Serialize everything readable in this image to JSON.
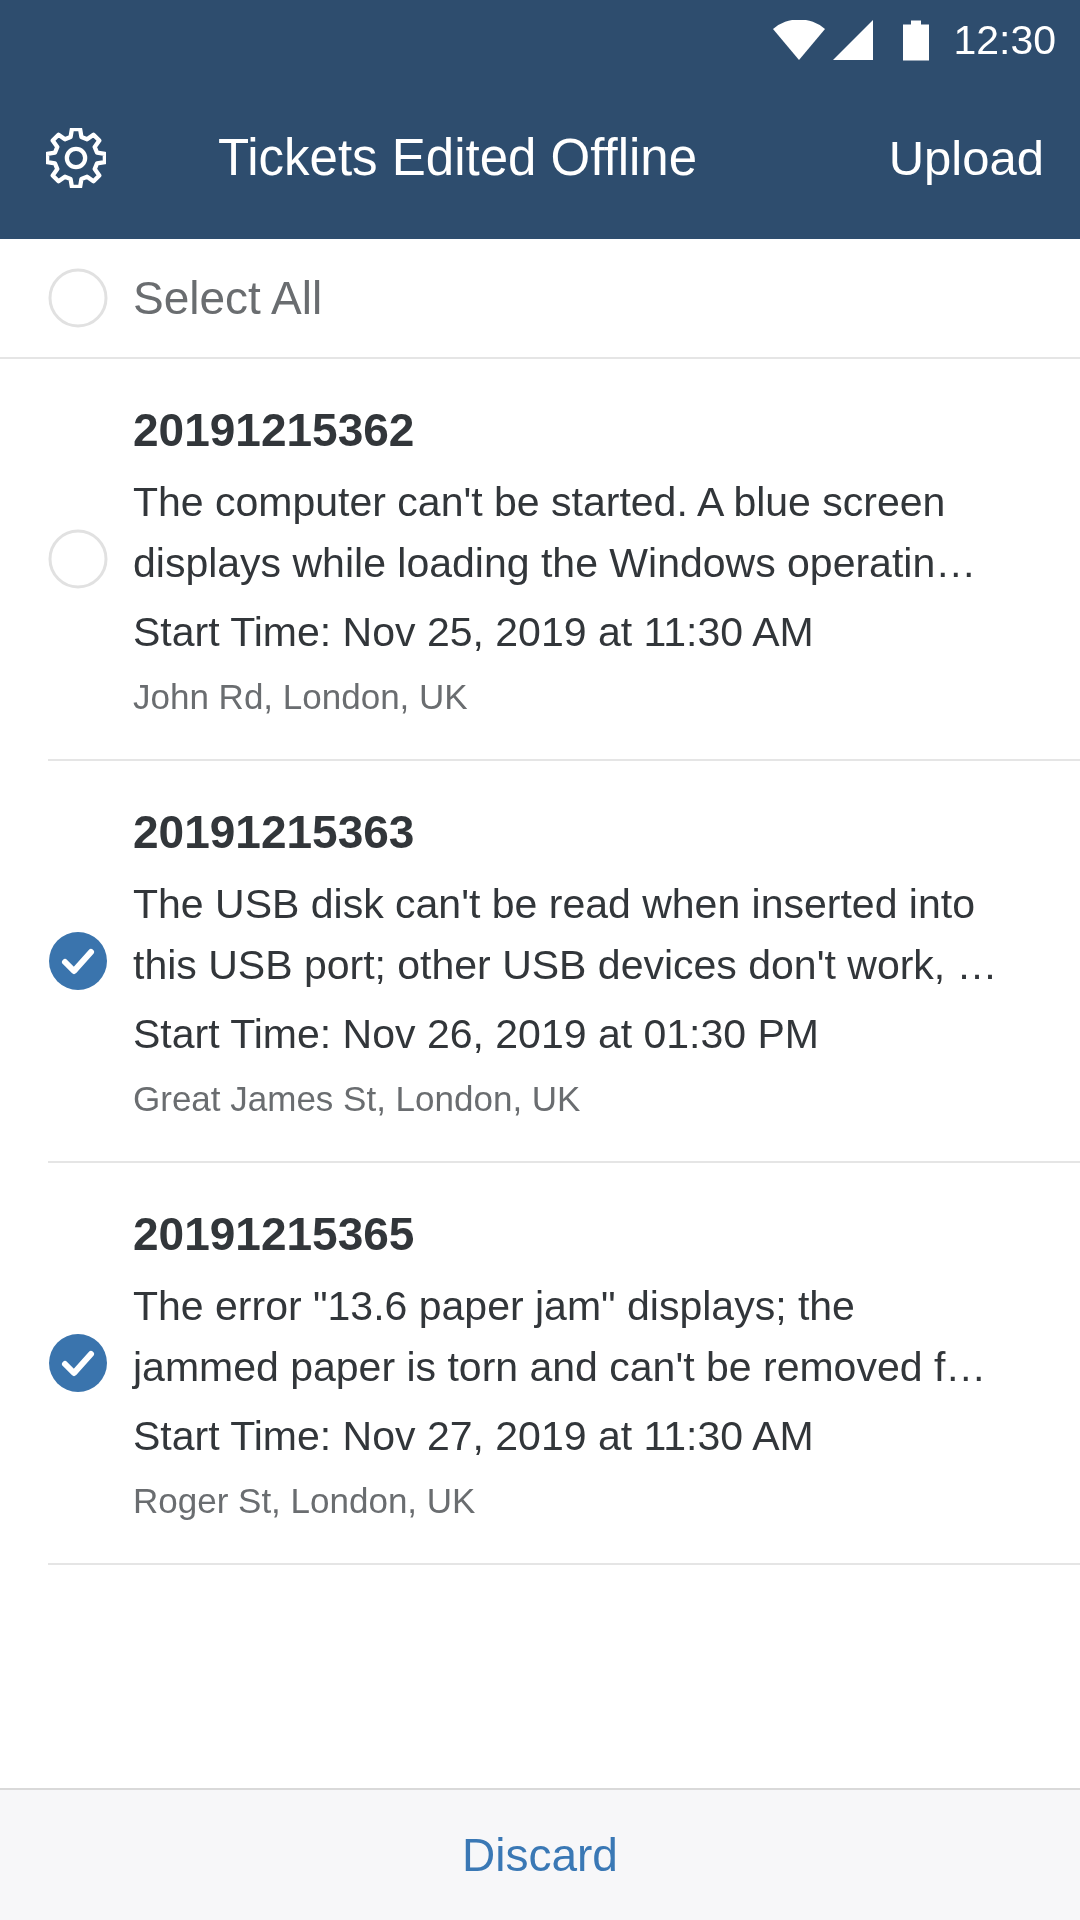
{
  "status_bar": {
    "time": "12:30"
  },
  "header": {
    "title": "Tickets Edited Offline",
    "action": "Upload"
  },
  "select_all": {
    "label": "Select All",
    "checked": false
  },
  "tickets": [
    {
      "number": "20191215362",
      "description": "The computer can't be started. A blue screen\ndisplays while loading the Windows operatin…",
      "start_time": "Start Time: Nov 25, 2019 at 11:30 AM",
      "address": "John Rd, London, UK",
      "checked": false
    },
    {
      "number": "20191215363",
      "description": "The USB disk can't be read when inserted into\nthis USB port; other USB devices don't work, …",
      "start_time": "Start Time: Nov 26, 2019 at 01:30 PM",
      "address": "Great James St, London, UK",
      "checked": true
    },
    {
      "number": "20191215365",
      "description": "The error \"13.6 paper jam\" displays; the\njammed paper is torn and can't be removed f…",
      "start_time": "Start Time: Nov 27, 2019 at 11:30 AM",
      "address": "Roger St, London, UK",
      "checked": true
    }
  ],
  "footer": {
    "button": "Discard"
  }
}
